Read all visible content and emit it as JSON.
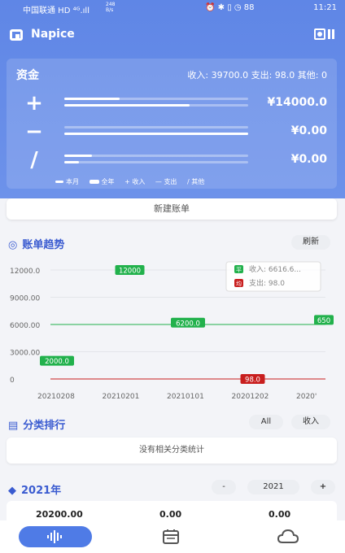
{
  "status": {
    "carrier": "中国联通 HD ⁴ᴳ.ıll",
    "net": "248 B/s",
    "time": "11:21",
    "icons": "⏰ ✱ ▯ ◷ 88"
  },
  "app": {
    "title": "Napice"
  },
  "funds": {
    "header": "资金",
    "summary": "收入: 39700.0  支出: 98.0  其他: 0",
    "rows": [
      {
        "symbol": "+",
        "amount": "¥14000.0",
        "month_fraction": 0.3,
        "year_fraction": 0.68
      },
      {
        "symbol": "−",
        "amount": "¥0.00",
        "month_fraction": 0.0,
        "year_fraction": 1.0
      },
      {
        "symbol": "/",
        "amount": "¥0.00",
        "month_fraction": 0.15,
        "year_fraction": 0.08
      }
    ],
    "legend": {
      "month": "本月",
      "year": "全年",
      "income": "收入",
      "expense": "支出",
      "other": "其他"
    }
  },
  "new_bill": "新建账单",
  "trend": {
    "title": "账单趋势",
    "refresh": "刷新"
  },
  "chart_data": {
    "type": "line",
    "x": [
      "20210208",
      "20210201",
      "20210101",
      "20201202",
      "2020'"
    ],
    "yticks": [
      "12000.0",
      "9000.00",
      "6000.00",
      "3000.00",
      "0"
    ],
    "ylim": [
      0,
      12000
    ],
    "series": [
      {
        "name": "收入",
        "color": "#22b14c",
        "values": [
          2000,
          12000,
          6200,
          6200,
          6500
        ],
        "labels": [
          "2000.0",
          "12000",
          "6200.0",
          "",
          "650"
        ]
      },
      {
        "name": "支出",
        "color": "#c81e1e",
        "values": [
          0,
          0,
          0,
          98,
          0
        ],
        "labels": [
          "",
          "",
          "",
          "98.0",
          ""
        ]
      }
    ],
    "avg_line": 6000,
    "tooltip": {
      "income": "收入: 6616.6...",
      "expense": "支出: 98.0",
      "income_tag": "平",
      "expense_tag": "均"
    }
  },
  "category": {
    "title": "分类排行",
    "btn_all": "All",
    "btn_income": "收入",
    "empty": "没有相关分类统计"
  },
  "year": {
    "title": "2021年",
    "minus": "-",
    "value": "2021",
    "plus": "+",
    "v1": "20200.00",
    "v2": "0.00",
    "v3": "0.00"
  },
  "colors": {
    "accent": "#4f7be6",
    "income": "#22b14c",
    "expense": "#c81e1e"
  }
}
